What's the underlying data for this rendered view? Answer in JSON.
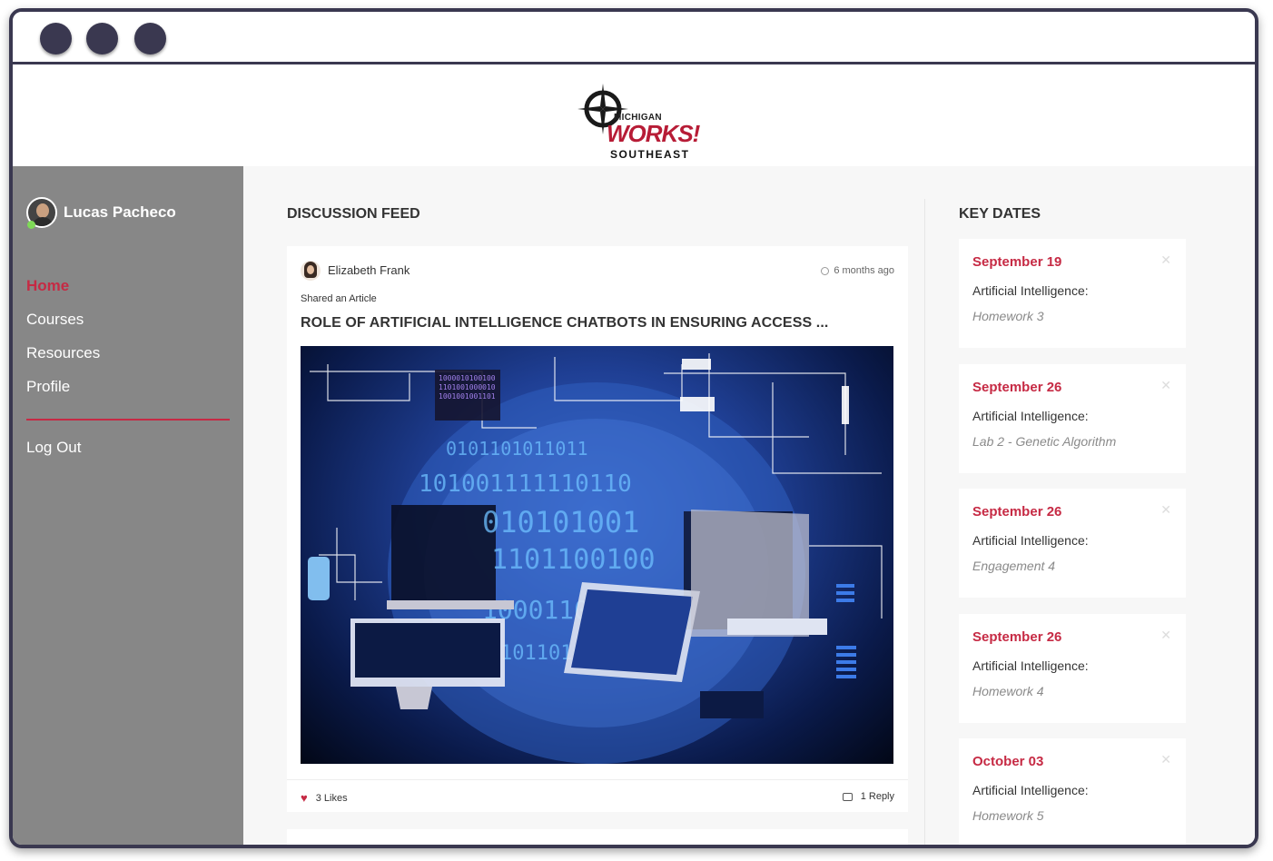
{
  "brand": {
    "line1": "MICHIGAN",
    "line2": "WORKS!",
    "line3": "SOUTHEAST"
  },
  "user": {
    "name": "Lucas Pacheco"
  },
  "nav": {
    "items": [
      "Home",
      "Courses",
      "Resources",
      "Profile"
    ],
    "active": "Home",
    "logout": "Log Out"
  },
  "feed": {
    "title": "DISCUSSION FEED",
    "post": {
      "author": "Elizabeth Frank",
      "time": "6 months ago",
      "action": "Shared an Article",
      "title": "ROLE OF ARTIFICIAL INTELLIGENCE CHATBOTS IN ENSURING ACCESS ...",
      "likes": "3 Likes",
      "replies": "1 Reply"
    }
  },
  "key_dates": {
    "title": "KEY DATES",
    "items": [
      {
        "date": "September 19",
        "course": "Artificial Intelligence:",
        "item": "Homework 3"
      },
      {
        "date": "September 26",
        "course": "Artificial Intelligence:",
        "item": "Lab 2 - Genetic Algorithm"
      },
      {
        "date": "September 26",
        "course": "Artificial Intelligence:",
        "item": "Engagement 4"
      },
      {
        "date": "September 26",
        "course": "Artificial Intelligence:",
        "item": "Homework 4"
      },
      {
        "date": "October 03",
        "course": "Artificial Intelligence:",
        "item": "Homework 5"
      }
    ]
  },
  "colors": {
    "accent": "#c62a44",
    "sidebar": "#878787",
    "frame": "#3a3850"
  },
  "icons": [
    "compass-logo-icon",
    "clock-icon",
    "heart-icon",
    "comment-icon",
    "close-icon",
    "online-status-icon"
  ]
}
